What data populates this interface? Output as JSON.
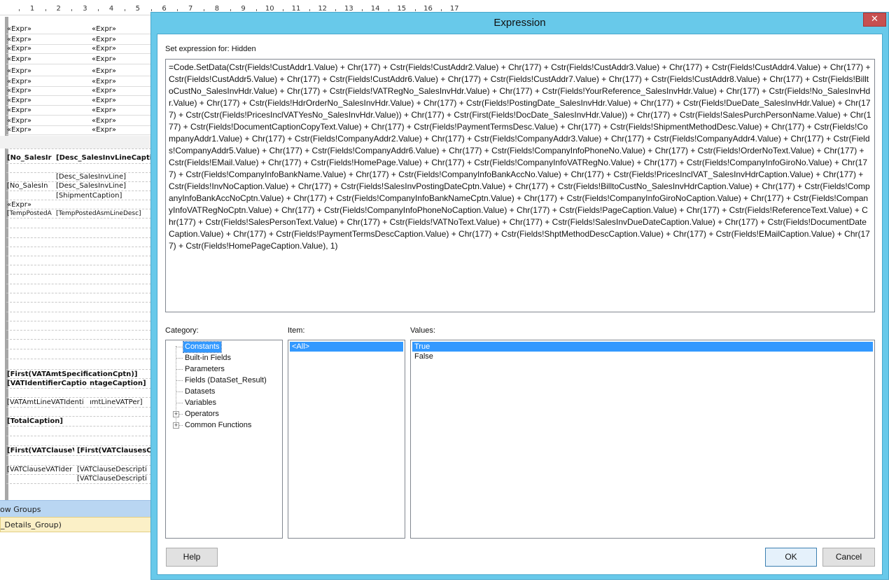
{
  "ruler": {
    "numbers": [
      "1",
      "2",
      "3",
      "4",
      "5",
      "6",
      "7",
      "8",
      "9",
      "10",
      "11",
      "12",
      "13",
      "14",
      "15",
      "16",
      "17"
    ]
  },
  "designer": {
    "expr_rows": [
      [
        "«Expr»",
        "«Expr»"
      ],
      [
        "«Expr»",
        "«Expr»"
      ],
      [
        "«Expr»",
        "«Expr»"
      ],
      [
        "«Expr»",
        "«Expr»"
      ],
      [
        "«Expr»",
        "«Expr»"
      ],
      [
        "«Expr»",
        "«Expr»"
      ],
      [
        "«Expr»",
        "«Expr»"
      ],
      [
        "«Expr»",
        "«Expr»"
      ],
      [
        "«Expr»",
        "«Expr»"
      ],
      [
        "«Expr»",
        "«Expr»"
      ],
      [
        "«Expr»",
        "«Expr»"
      ]
    ],
    "line_header_left": "[No_SalesIr",
    "line_header_right": "[Desc_SalesInvLineCaption",
    "line_desc_1": "[Desc_SalesInvLine]",
    "line_no": "[No_SalesIn",
    "line_desc_2": "[Desc_SalesInvLine]",
    "shipment_caption": "[ShipmentCaption]",
    "expr_single": "«Expr»",
    "temp_posted_a": "[TempPostedA",
    "temp_posted_desc": "[TempPostedAsmLineDesc]",
    "vat_amt_spec": "[First(VATAmtSpecificationCptn)]",
    "vat_identifier_caption": "[VATIdentifierCaption",
    "vat_percentage_caption": "ntageCaption]",
    "vat_amt_line_identifier": "[VATAmtLineVATIdenti",
    "vat_amt_line_per": "ımtLineVATPer]",
    "total_caption": "[TotalCaption]",
    "vat_clause_first": "[First(VATClauseV.",
    "vat_clauses_caption": "[First(VATClausesCa",
    "vat_clause_identifier": "[VATClauseVATIder",
    "vat_clause_desc_1": "[VATClauseDescripti",
    "vat_clause_desc_2": "[VATClauseDescripti",
    "row_groups_label": "ow Groups",
    "details_group_label": "_Details_Group)"
  },
  "dialog": {
    "title": "Expression",
    "close_label": "✕",
    "set_expression_label": "Set expression for: Hidden",
    "expression": "=Code.SetData(Cstr(Fields!CustAddr1.Value) + Chr(177) + Cstr(Fields!CustAddr2.Value) + Chr(177) + Cstr(Fields!CustAddr3.Value) + Chr(177) + Cstr(Fields!CustAddr4.Value) + Chr(177) + Cstr(Fields!CustAddr5.Value) + Chr(177) + Cstr(Fields!CustAddr6.Value) + Chr(177) + Cstr(Fields!CustAddr7.Value) + Chr(177) + Cstr(Fields!CustAddr8.Value) + Chr(177) + Cstr(Fields!BilltoCustNo_SalesInvHdr.Value) + Chr(177) + Cstr(Fields!VATRegNo_SalesInvHdr.Value) + Chr(177) + Cstr(Fields!YourReference_SalesInvHdr.Value) + Chr(177) + Cstr(Fields!No_SalesInvHdr.Value) + Chr(177) + Cstr(Fields!HdrOrderNo_SalesInvHdr.Value) + Chr(177) + Cstr(Fields!PostingDate_SalesInvHdr.Value) + Chr(177) + Cstr(Fields!DueDate_SalesInvHdr.Value) + Chr(177) + Cstr(Cstr(Fields!PricesInclVATYesNo_SalesInvHdr.Value)) + Chr(177) + Cstr(First(Fields!DocDate_SalesInvHdr.Value)) + Chr(177) + Cstr(Fields!SalesPurchPersonName.Value) + Chr(177) + Cstr(Fields!DocumentCaptionCopyText.Value) + Chr(177) + Cstr(Fields!PaymentTermsDesc.Value) + Chr(177) + Cstr(Fields!ShipmentMethodDesc.Value) + Chr(177) + Cstr(Fields!CompanyAddr1.Value) + Chr(177) + Cstr(Fields!CompanyAddr2.Value) + Chr(177) + Cstr(Fields!CompanyAddr3.Value) + Chr(177) + Cstr(Fields!CompanyAddr4.Value) + Chr(177) + Cstr(Fields!CompanyAddr5.Value) + Chr(177) + Cstr(Fields!CompanyAddr6.Value) + Chr(177) + Cstr(Fields!CompanyInfoPhoneNo.Value) + Chr(177) + Cstr(Fields!OrderNoText.Value) + Chr(177) + Cstr(Fields!EMail.Value) + Chr(177) + Cstr(Fields!HomePage.Value) + Chr(177) + Cstr(Fields!CompanyInfoVATRegNo.Value) + Chr(177) + Cstr(Fields!CompanyInfoGiroNo.Value) + Chr(177) + Cstr(Fields!CompanyInfoBankName.Value) + Chr(177) + Cstr(Fields!CompanyInfoBankAccNo.Value) + Chr(177) + Cstr(Fields!PricesInclVAT_SalesInvHdrCaption.Value) + Chr(177) + Cstr(Fields!InvNoCaption.Value) + Chr(177) + Cstr(Fields!SalesInvPostingDateCptn.Value) + Chr(177) + Cstr(Fields!BilltoCustNo_SalesInvHdrCaption.Value) + Chr(177) + Cstr(Fields!CompanyInfoBankAccNoCptn.Value) + Chr(177) + Cstr(Fields!CompanyInfoBankNameCptn.Value) + Chr(177) + Cstr(Fields!CompanyInfoGiroNoCaption.Value) + Chr(177) + Cstr(Fields!CompanyInfoVATRegNoCptn.Value) + Chr(177) + Cstr(Fields!CompanyInfoPhoneNoCaption.Value) + Chr(177) + Cstr(Fields!PageCaption.Value) + Chr(177) + Cstr(Fields!ReferenceText.Value) + Chr(177) + Cstr(Fields!SalesPersonText.Value) + Chr(177) + Cstr(Fields!VATNoText.Value) + Chr(177) + Cstr(Fields!SalesInvDueDateCaption.Value) + Chr(177) + Cstr(Fields!DocumentDateCaption.Value) + Chr(177) + Cstr(Fields!PaymentTermsDescCaption.Value) + Chr(177) + Cstr(Fields!ShptMethodDescCaption.Value) + Chr(177) + Cstr(Fields!EMailCaption.Value) + Chr(177) + Cstr(Fields!HomePageCaption.Value), 1)",
    "category_label": "Category:",
    "item_label": "Item:",
    "values_label": "Values:",
    "categories": [
      "Constants",
      "Built-in Fields",
      "Parameters",
      "Fields (DataSet_Result)",
      "Datasets",
      "Variables",
      "Operators",
      "Common Functions"
    ],
    "items": [
      "<All>"
    ],
    "values": [
      "True",
      "False"
    ],
    "help_label": "Help",
    "ok_label": "OK",
    "cancel_label": "Cancel"
  },
  "colors": {
    "title_bar": "#68c9ea",
    "close_button": "#c75050",
    "selection": "#3399ff",
    "row_groups_bar": "#b9d6f2",
    "details_group_bar": "#fbf0c7"
  }
}
